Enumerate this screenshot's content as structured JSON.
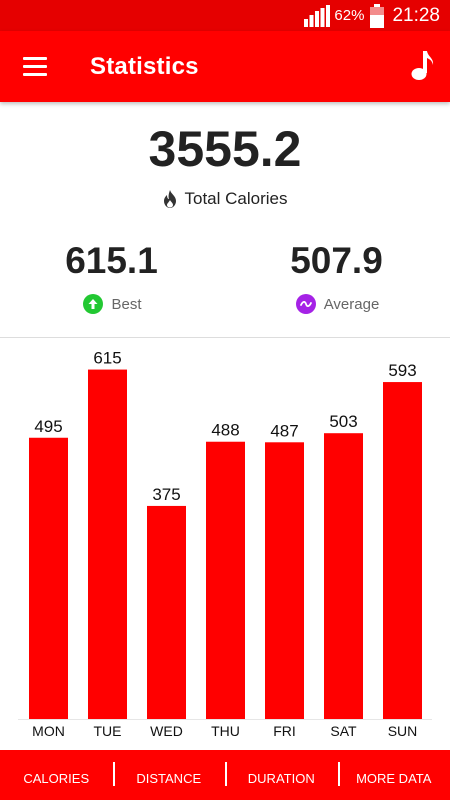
{
  "status_bar": {
    "battery_percent": "62%",
    "time": "21:28",
    "signal_icon": "signal-bars-icon",
    "battery_icon": "battery-icon"
  },
  "app_bar": {
    "title": "Statistics",
    "menu_icon": "hamburger-menu-icon",
    "action_icon": "music-note-icon"
  },
  "summary": {
    "total_value": "3555.2",
    "total_label": "Total Calories",
    "best_value": "615.1",
    "best_label": "Best",
    "average_value": "507.9",
    "average_label": "Average"
  },
  "colors": {
    "primary": "#ff0000",
    "status_bar": "#e50000",
    "best_badge": "#22c832",
    "average_badge": "#a522e6",
    "text_dark": "#222222",
    "text_muted": "#666666"
  },
  "chart_data": {
    "type": "bar",
    "categories": [
      "MON",
      "TUE",
      "WED",
      "THU",
      "FRI",
      "SAT",
      "SUN"
    ],
    "values": [
      495,
      615,
      375,
      488,
      487,
      503,
      593
    ],
    "data_labels": [
      "495",
      "615",
      "375",
      "488",
      "487",
      "503",
      "593"
    ],
    "ylim": [
      0,
      660
    ],
    "grid": false,
    "bar_color": "#ff0000"
  },
  "bottom_nav": {
    "items": [
      "CALORIES",
      "DISTANCE",
      "DURATION",
      "MORE DATA"
    ]
  }
}
